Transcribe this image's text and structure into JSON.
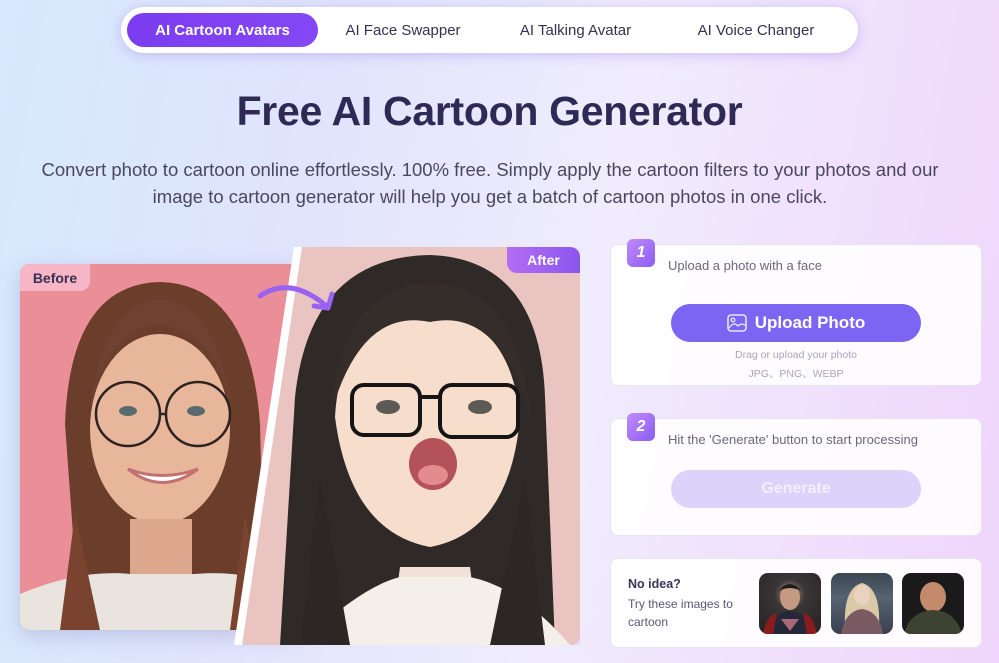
{
  "nav": {
    "tabs": [
      {
        "label": "AI Cartoon Avatars",
        "active": true
      },
      {
        "label": "AI Face Swapper",
        "active": false
      },
      {
        "label": "AI Talking Avatar",
        "active": false
      },
      {
        "label": "AI Voice Changer",
        "active": false
      }
    ]
  },
  "hero": {
    "title": "Free AI Cartoon Generator",
    "subtitle_line1": "Convert photo to cartoon online effortlessly. 100% free. Simply apply the cartoon filters to your photos and our",
    "subtitle_line2": "image to cartoon generator will help you get a batch of cartoon photos in one click."
  },
  "comparison": {
    "before_label": "Before",
    "after_label": "After",
    "arrow_icon": "curved-arrow-icon"
  },
  "steps": [
    {
      "number": "1",
      "instruction": "Upload a photo with a face",
      "button_label": "Upload Photo",
      "button_icon": "image-icon",
      "hint": "Drag or upload your photo",
      "formats": "JPG、PNG、WEBP"
    },
    {
      "number": "2",
      "instruction": "Hit the 'Generate' button to start processing",
      "button_label": "Generate",
      "button_state": "disabled"
    }
  ],
  "samples": {
    "title": "No idea?",
    "text": "Try these images to cartoon",
    "images": [
      {
        "name": "superhero-sample"
      },
      {
        "name": "blonde-woman-sample"
      },
      {
        "name": "bald-man-sample"
      }
    ]
  },
  "colors": {
    "accent": "#7c3aed",
    "button": "#7c65f2",
    "button_disabled": "#dcd3fb",
    "title": "#2e2a55"
  }
}
